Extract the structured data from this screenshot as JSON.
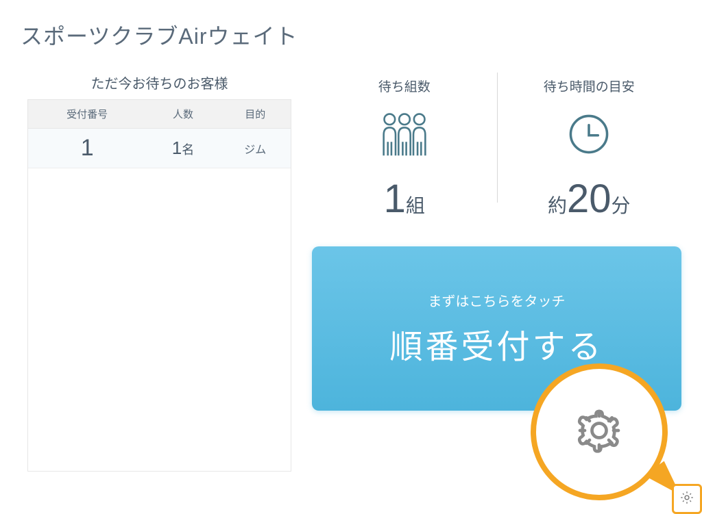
{
  "title": "スポーツクラブAirウェイト",
  "waiting": {
    "heading": "ただ今お待ちのお客様",
    "columns": {
      "ticket": "受付番号",
      "people": "人数",
      "purpose": "目的"
    },
    "rows": [
      {
        "ticket": "1",
        "people_num": "1",
        "people_unit": "名",
        "purpose": "ジム"
      }
    ]
  },
  "stats": {
    "groups": {
      "label": "待ち組数",
      "value": "1",
      "unit": "組"
    },
    "time": {
      "label": "待ち時間の目安",
      "prefix": "約",
      "value": "20",
      "unit": "分"
    }
  },
  "main_button": {
    "hint": "まずはこちらをタッチ",
    "label": "順番受付する"
  },
  "icons": {
    "people_group": "people-group-icon",
    "clock": "clock-icon",
    "gear": "gear-icon"
  },
  "colors": {
    "accent": "#f5a623",
    "primary": "#4db4dc",
    "text": "#4a5a6a"
  }
}
